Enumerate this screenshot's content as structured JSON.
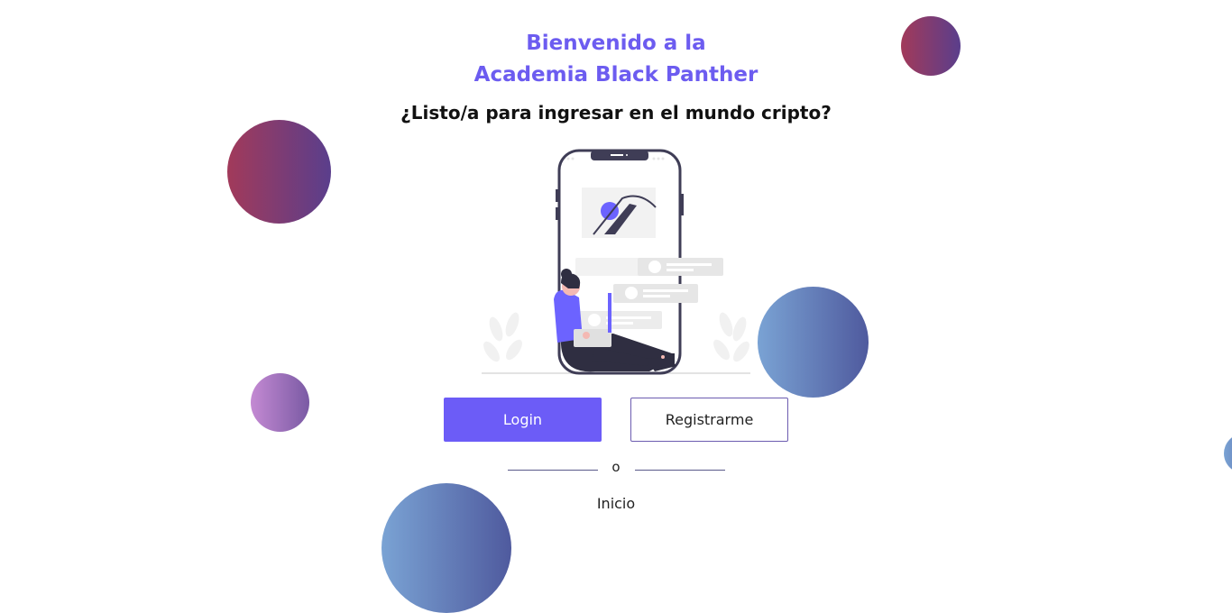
{
  "header": {
    "title_line1": "Bienvenido a la",
    "title_line2": "Academia Black Panther",
    "subtitle": "¿Listo/a para ingresar en el mundo cripto?"
  },
  "illustration": {
    "name": "woman-with-phone-illustration"
  },
  "actions": {
    "login_label": "Login",
    "register_label": "Registrarme",
    "separator": "o",
    "home_label": "Inicio"
  },
  "colors": {
    "accent": "#6c5cf7",
    "title": "#6c5cf0",
    "bubble_purple_from": "#a23a5a",
    "bubble_purple_to": "#5a3e8c",
    "bubble_blue_from": "#7aa3d4",
    "bubble_blue_to": "#4f5a9e"
  }
}
